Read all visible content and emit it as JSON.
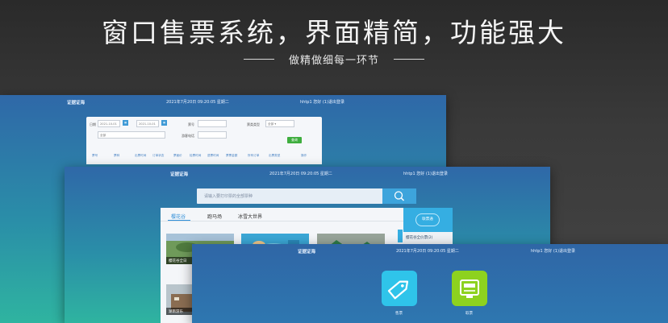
{
  "hero": {
    "title": "窗口售票系统，界面精简，功能强大",
    "subtitle": "做精做细每一环节"
  },
  "app": {
    "brand": "证据证海",
    "clock": "2021年7月20日 09:20:05 星期二",
    "user_label": "hhtp1",
    "greeting": "您好",
    "logout": "(1)退出登录"
  },
  "query_form": {
    "date_label": "日期",
    "date_from": "2021-10-01",
    "date_to": "2021-10-01",
    "status_label": "票号",
    "type_label": "票类类型",
    "type_value": "全部",
    "type_dropdown_value": "全部",
    "agent_label": "游客电话",
    "search_button": "查询"
  },
  "order_table": {
    "columns": [
      "票号",
      "票种",
      "出票时间",
      "订单状态",
      "票面价",
      "检票时间",
      "退票时间",
      "票票金额",
      "所有订单",
      "出票类型",
      "操作"
    ]
  },
  "ticket_search": {
    "placeholder": "请输入要打印票的全部票种"
  },
  "ticket_tabs": [
    {
      "label": "樱花谷"
    },
    {
      "label": "跑马场"
    },
    {
      "label": "冰雪大世界"
    }
  ],
  "ticket_thumbs": [
    {
      "caption": "樱花谷全日"
    },
    {
      "caption": ""
    },
    {
      "caption": ""
    },
    {
      "caption": "湖南游乐"
    }
  ],
  "side_panel": {
    "logo": "联票通",
    "item": "樱花谷全价票(2)"
  },
  "actions": [
    {
      "label": "售票",
      "icon": "tag-icon",
      "color": "#2fc4ea"
    },
    {
      "label": "取票",
      "icon": "ticket-machine-icon",
      "color": "#8dd21f"
    }
  ]
}
